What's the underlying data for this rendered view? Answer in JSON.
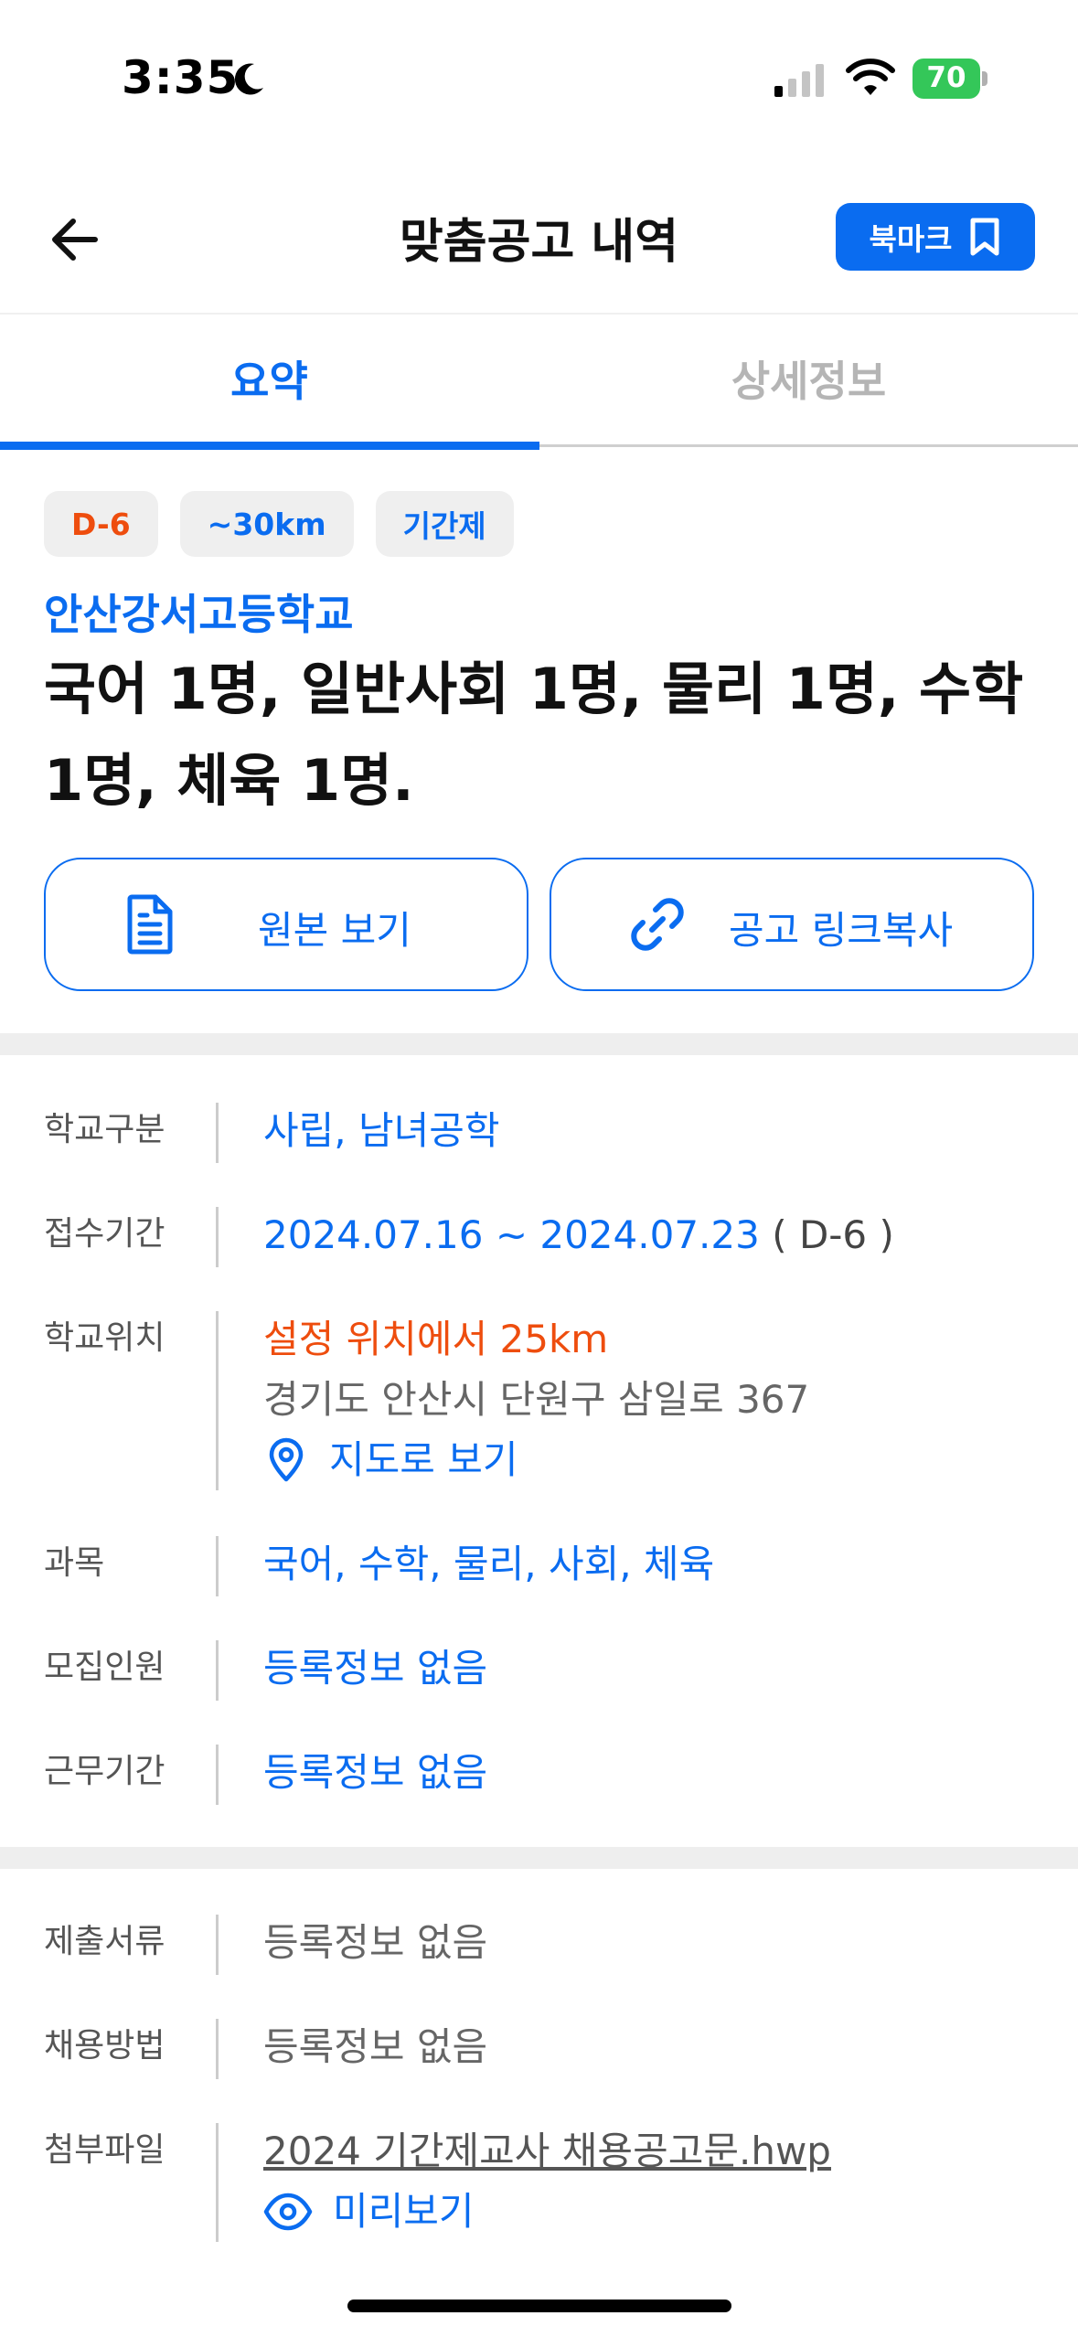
{
  "status_bar": {
    "time": "3:35",
    "battery": "70"
  },
  "header": {
    "title": "맞춤공고 내역",
    "bookmark_label": "북마크"
  },
  "tabs": [
    {
      "label": "요약",
      "active": true
    },
    {
      "label": "상세정보",
      "active": false
    }
  ],
  "tags": {
    "dday": "D-6",
    "distance": "~30km",
    "type": "기간제"
  },
  "school": "안산강서고등학교",
  "job_title": "국어 1명, 일반사회 1명, 물리 1명, 수학 1명, 체육 1명.",
  "actions": {
    "view_original": "원본 보기",
    "copy_link": "공고 링크복사"
  },
  "info": {
    "school_type": {
      "label": "학교구분",
      "value": "사립, 남녀공학"
    },
    "period": {
      "label": "접수기간",
      "value": "2024.07.16 ~ 2024.07.23",
      "suffix": "( D-6 )"
    },
    "location": {
      "label": "학교위치",
      "distance": "설정 위치에서 25km",
      "address": "경기도 안산시 단원구 삼일로 367",
      "map_link": "지도로 보기"
    },
    "subjects": {
      "label": "과목",
      "value": "국어, 수학, 물리, 사회, 체육"
    },
    "recruit_count": {
      "label": "모집인원",
      "value": "등록정보 없음"
    },
    "work_period": {
      "label": "근무기간",
      "value": "등록정보 없음"
    },
    "documents": {
      "label": "제출서류",
      "value": "등록정보 없음"
    },
    "hiring_method": {
      "label": "채용방법",
      "value": "등록정보 없음"
    },
    "attachment": {
      "label": "첨부파일",
      "file_name": "2024 기간제교사 채용공고문.hwp",
      "preview": "미리보기"
    }
  },
  "colors": {
    "accent": "#0a6cf0",
    "dday": "#ee4d0e",
    "battery": "#34c759"
  }
}
